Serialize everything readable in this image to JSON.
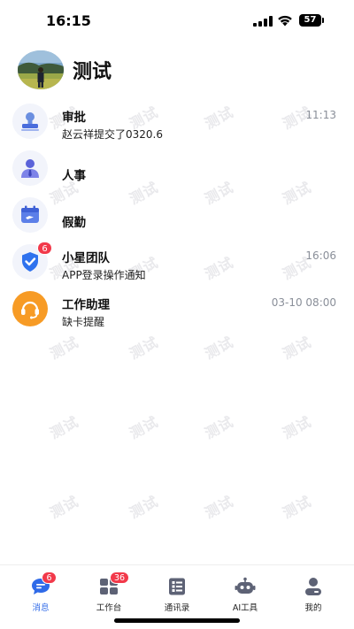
{
  "status_bar": {
    "time": "16:15",
    "battery": "57"
  },
  "header": {
    "title": "测试"
  },
  "watermark_text": "测试",
  "messages": [
    {
      "title": "审批",
      "subtitle": "赵云祥提交了0320.6",
      "time": "11:13",
      "icon": "approval-stamp-icon"
    },
    {
      "title": "人事",
      "subtitle": "",
      "time": "",
      "icon": "personnel-icon"
    },
    {
      "title": "假勤",
      "subtitle": "",
      "time": "",
      "icon": "leave-calendar-icon"
    },
    {
      "title": "小星团队",
      "subtitle": "APP登录操作通知",
      "time": "16:06",
      "badge": "6",
      "icon": "shield-check-icon"
    },
    {
      "title": "工作助理",
      "subtitle": "缺卡提醒",
      "time": "03-10 08:00",
      "icon": "headset-assistant-icon"
    }
  ],
  "tabs": [
    {
      "label": "消息",
      "badge": "6",
      "active": true,
      "icon": "chat-bubble-icon"
    },
    {
      "label": "工作台",
      "badge": "36",
      "active": false,
      "icon": "grid-apps-icon"
    },
    {
      "label": "通讯录",
      "badge": "",
      "active": false,
      "icon": "contacts-book-icon"
    },
    {
      "label": "AI工具",
      "badge": "",
      "active": false,
      "icon": "robot-icon"
    },
    {
      "label": "我的",
      "badge": "",
      "active": false,
      "icon": "profile-icon"
    }
  ],
  "colors": {
    "accent_blue": "#2f6ae8",
    "badge_red": "#f2394a",
    "assistant_orange": "#f79b25",
    "icon_purple": "#6a6ee6"
  }
}
